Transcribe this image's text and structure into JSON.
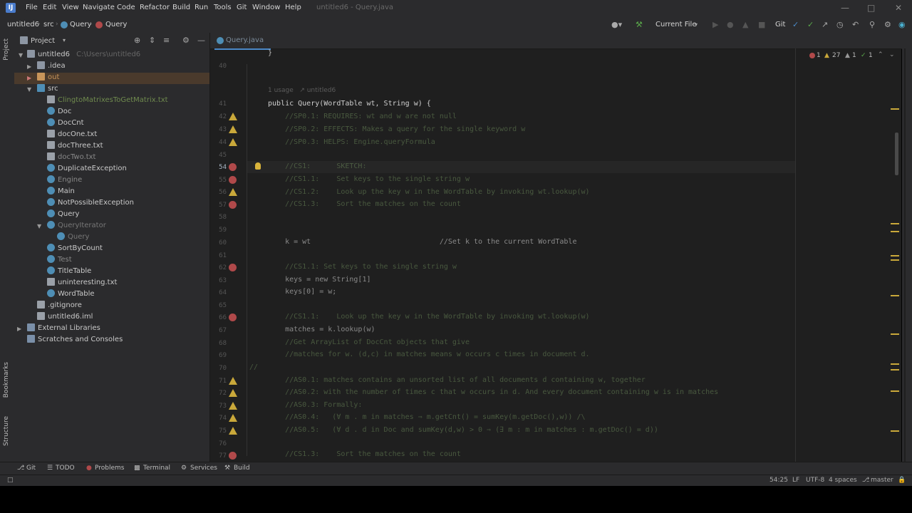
{
  "menubar": {
    "logo": "IJ",
    "items": [
      "File",
      "Edit",
      "View",
      "Navigate",
      "Code",
      "Refactor",
      "Build",
      "Run",
      "Tools",
      "Git",
      "Window",
      "Help"
    ],
    "title": "untitled6 - Query.java"
  },
  "toolbar": {
    "breadcrumb": [
      "untitled6",
      "src",
      "Query",
      "Query"
    ],
    "run_config": "Current File",
    "git_label": "Git"
  },
  "left_strip": {
    "project": "Project",
    "bookmarks": "Bookmarks",
    "structure": "Structure"
  },
  "project_panel": {
    "header": "Project",
    "root": {
      "name": "untitled6",
      "path": "C:\\Users\\untitled6"
    },
    "items": [
      {
        "name": ".idea",
        "kind": "folder",
        "level": 1
      },
      {
        "name": "out",
        "kind": "folder",
        "level": 1
      },
      {
        "name": "src",
        "kind": "folder",
        "level": 1
      },
      {
        "name": "ClingtoMatrixesToGetMatrix.txt",
        "kind": "file",
        "level": 2
      },
      {
        "name": "Doc",
        "kind": "class",
        "level": 2
      },
      {
        "name": "DocCnt",
        "kind": "class",
        "level": 2
      },
      {
        "name": "docOne.txt",
        "kind": "file",
        "level": 2
      },
      {
        "name": "docThree.txt",
        "kind": "file",
        "level": 2
      },
      {
        "name": "docTwo.txt",
        "kind": "file",
        "level": 2
      },
      {
        "name": "DuplicateException",
        "kind": "class",
        "level": 2
      },
      {
        "name": "Engine",
        "kind": "class",
        "level": 2
      },
      {
        "name": "Main",
        "kind": "class",
        "level": 2
      },
      {
        "name": "NotPossibleException",
        "kind": "class",
        "level": 2
      },
      {
        "name": "Query",
        "kind": "class",
        "level": 2
      },
      {
        "name": "QueryIterator",
        "kind": "class",
        "level": 2
      },
      {
        "name": "Query",
        "kind": "class",
        "level": 3
      },
      {
        "name": "SortByCount",
        "kind": "class",
        "level": 2
      },
      {
        "name": "Test",
        "kind": "class",
        "level": 2
      },
      {
        "name": "TitleTable",
        "kind": "class",
        "level": 2
      },
      {
        "name": "uninteresting.txt",
        "kind": "file",
        "level": 2
      },
      {
        "name": "WordTable",
        "kind": "class",
        "level": 2
      },
      {
        "name": ".gitignore",
        "kind": "file",
        "level": 1
      },
      {
        "name": "untitled6.iml",
        "kind": "file",
        "level": 1
      },
      {
        "name": "External Libraries",
        "kind": "lib",
        "level": 0
      },
      {
        "name": "Scratches and Consoles",
        "kind": "lib",
        "level": 0
      }
    ]
  },
  "editor": {
    "tab": "Query.java",
    "inspections": {
      "errors": "1",
      "warnings": "27",
      "weak_warnings": "1",
      "ok": "1"
    },
    "usage_hint": "1 usage   ↗ untitled6",
    "lines": [
      {
        "n": "",
        "text": "}"
      },
      {
        "n": "40",
        "text": ""
      },
      {
        "n": "41",
        "text": "public Query(WordTable wt, String w) {"
      },
      {
        "n": "42",
        "text": "    //SP0.1: REQUIRES: wt and w are not null"
      },
      {
        "n": "43",
        "text": "    //SP0.2: EFFECTS: Makes a query for the single keyword w"
      },
      {
        "n": "44",
        "text": "    //SP0.3: HELPS: Engine.queryFormula"
      },
      {
        "n": "45",
        "text": ""
      },
      {
        "n": "54",
        "text": "    //CS1:      SKETCH:"
      },
      {
        "n": "55",
        "text": "    //CS1.1:    Set keys to the single string w"
      },
      {
        "n": "56",
        "text": "    //CS1.2:    Look up the key w in the WordTable by invoking wt.lookup(w)"
      },
      {
        "n": "57",
        "text": "    //CS1.3:    Sort the matches on the count"
      },
      {
        "n": "58",
        "text": ""
      },
      {
        "n": "59",
        "text": ""
      },
      {
        "n": "60",
        "text": "    k = wt                              //Set k to the current WordTable"
      },
      {
        "n": "61",
        "text": ""
      },
      {
        "n": "62",
        "text": "    //CS1.1: Set keys to the single string w"
      },
      {
        "n": "63",
        "text": "    keys = new String[1]"
      },
      {
        "n": "64",
        "text": "    keys[0] = w;"
      },
      {
        "n": "65",
        "text": ""
      },
      {
        "n": "66",
        "text": "    //CS1.1:    Look up the key w in the WordTable by invoking wt.lookup(w)"
      },
      {
        "n": "67",
        "text": "    matches = k.lookup(w)"
      },
      {
        "n": "68",
        "text": "    //Get ArrayList of DocCnt objects that give"
      },
      {
        "n": "69",
        "text": "    //matches for w. (d,c) in matches means w occurs c times in document d."
      },
      {
        "n": "70",
        "text": "//"
      },
      {
        "n": "71",
        "text": "    //AS0.1: matches contains an unsorted list of all documents d containing w, together"
      },
      {
        "n": "72",
        "text": "    //AS0.2: with the number of times c that w occurs in d. And every document containing w is in matches"
      },
      {
        "n": "73",
        "text": "    //AS0.3: Formally:"
      },
      {
        "n": "74",
        "text": "    //AS0.4:   (∀ m . m in matches ⇒ m.getCnt() = sumKey(m.getDoc(),w)) /\\"
      },
      {
        "n": "75",
        "text": "    //AS0.5:   (∀ d . d in Doc and sumKey(d,w) > 0 ⇒ (∃ m : m in matches : m.getDoc() = d))"
      },
      {
        "n": "76",
        "text": ""
      },
      {
        "n": "77",
        "text": "    //CS1.3:    Sort the matches on the count"
      }
    ]
  },
  "bottom_tools": [
    "Git",
    "TODO",
    "Problems",
    "Terminal",
    "Services",
    "Build"
  ],
  "status": {
    "position": "54:25",
    "line_sep": "LF",
    "encoding": "UTF-8",
    "indent": "4 spaces",
    "branch": "master"
  },
  "colors": {
    "accent": "#4a88c7",
    "warning": "#c9a83a",
    "error": "#b0494a",
    "editor_bg": "#1f1f1f",
    "panel_bg": "#2b2b2d"
  }
}
